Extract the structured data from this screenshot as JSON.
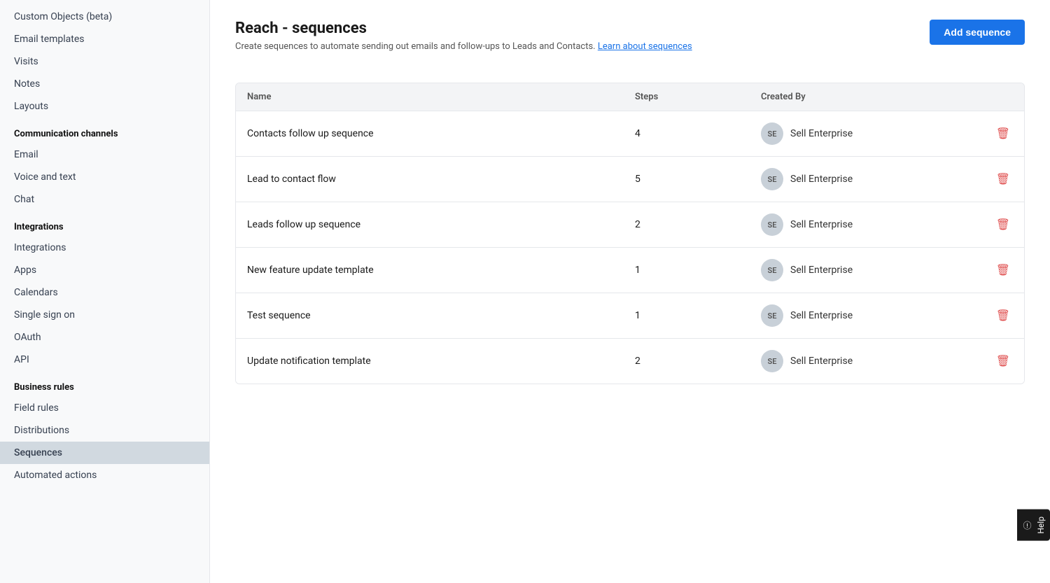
{
  "sidebar": {
    "items_top": [
      {
        "id": "custom-objects",
        "label": "Custom Objects (beta)",
        "active": false
      },
      {
        "id": "email-templates",
        "label": "Email templates",
        "active": false
      },
      {
        "id": "visits",
        "label": "Visits",
        "active": false
      },
      {
        "id": "notes",
        "label": "Notes",
        "active": false
      },
      {
        "id": "layouts",
        "label": "Layouts",
        "active": false
      }
    ],
    "sections": [
      {
        "id": "communication-channels",
        "label": "Communication channels",
        "items": [
          {
            "id": "email",
            "label": "Email",
            "active": false
          },
          {
            "id": "voice-and-text",
            "label": "Voice and text",
            "active": false
          },
          {
            "id": "chat",
            "label": "Chat",
            "active": false
          }
        ]
      },
      {
        "id": "integrations",
        "label": "Integrations",
        "items": [
          {
            "id": "integrations",
            "label": "Integrations",
            "active": false
          },
          {
            "id": "apps",
            "label": "Apps",
            "active": false
          },
          {
            "id": "calendars",
            "label": "Calendars",
            "active": false
          },
          {
            "id": "single-sign-on",
            "label": "Single sign on",
            "active": false
          },
          {
            "id": "oauth",
            "label": "OAuth",
            "active": false
          },
          {
            "id": "api",
            "label": "API",
            "active": false
          }
        ]
      },
      {
        "id": "business-rules",
        "label": "Business rules",
        "items": [
          {
            "id": "field-rules",
            "label": "Field rules",
            "active": false
          },
          {
            "id": "distributions",
            "label": "Distributions",
            "active": false
          },
          {
            "id": "sequences",
            "label": "Sequences",
            "active": true
          },
          {
            "id": "automated-actions",
            "label": "Automated actions",
            "active": false
          }
        ]
      }
    ]
  },
  "main": {
    "page_title": "Reach - sequences",
    "page_description": "Create sequences to automate sending out emails and follow-ups to Leads and Contacts.",
    "learn_link_text": "Learn about sequences",
    "add_button_label": "Add sequence",
    "table": {
      "columns": [
        {
          "id": "name",
          "label": "Name"
        },
        {
          "id": "steps",
          "label": "Steps"
        },
        {
          "id": "created-by",
          "label": "Created By"
        },
        {
          "id": "actions",
          "label": ""
        }
      ],
      "rows": [
        {
          "id": 1,
          "name": "Contacts follow up sequence",
          "steps": "4",
          "avatar_initials": "SE",
          "created_by": "Sell Enterprise"
        },
        {
          "id": 2,
          "name": "Lead to contact flow",
          "steps": "5",
          "avatar_initials": "SE",
          "created_by": "Sell Enterprise"
        },
        {
          "id": 3,
          "name": "Leads follow up sequence",
          "steps": "2",
          "avatar_initials": "SE",
          "created_by": "Sell Enterprise"
        },
        {
          "id": 4,
          "name": "New feature update template",
          "steps": "1",
          "avatar_initials": "SE",
          "created_by": "Sell Enterprise"
        },
        {
          "id": 5,
          "name": "Test sequence",
          "steps": "1",
          "avatar_initials": "SE",
          "created_by": "Sell Enterprise"
        },
        {
          "id": 6,
          "name": "Update notification template",
          "steps": "2",
          "avatar_initials": "SE",
          "created_by": "Sell Enterprise"
        }
      ]
    }
  },
  "help": {
    "label": "Help"
  }
}
